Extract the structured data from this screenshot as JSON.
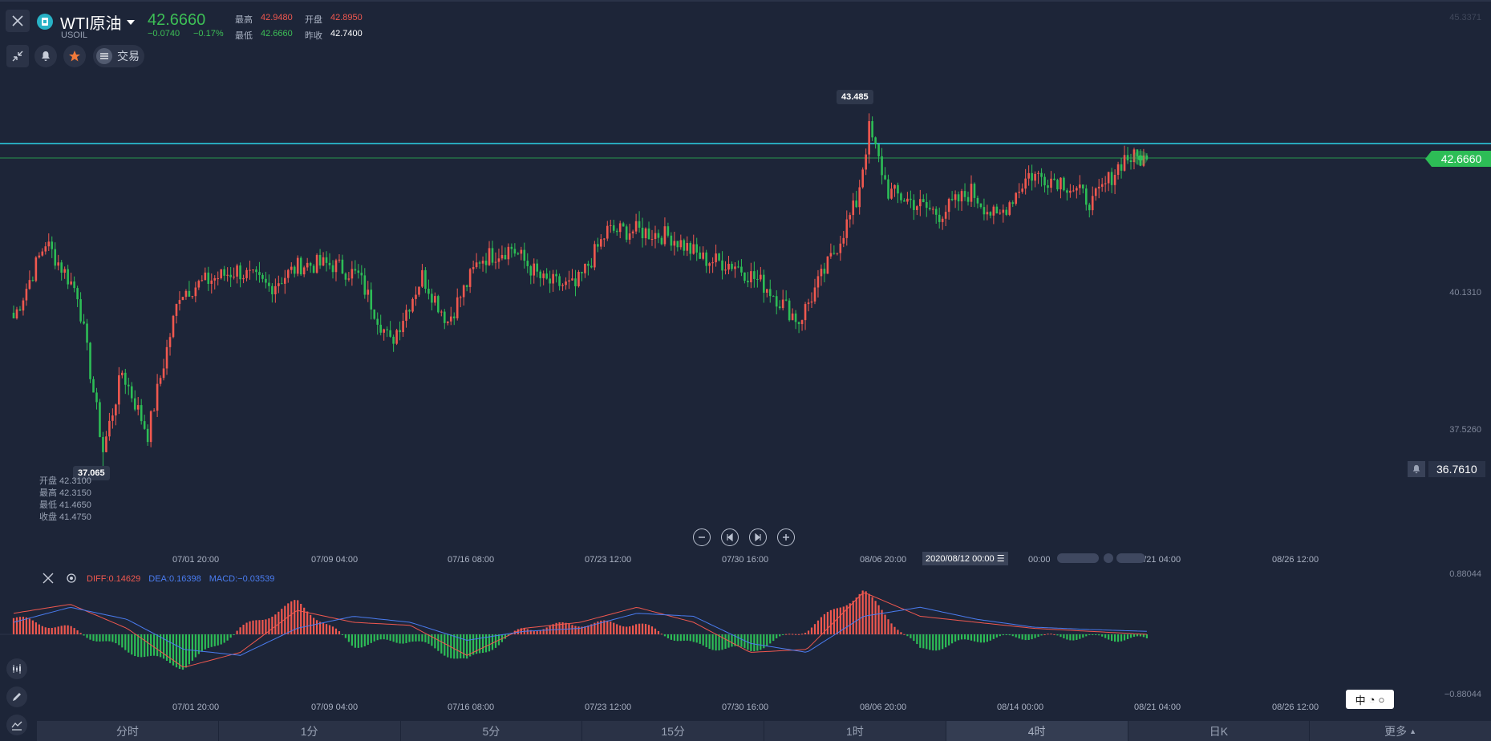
{
  "header": {
    "symbol_name": "WTI原油",
    "symbol_code": "USOIL",
    "last_price": "42.6660",
    "change": "−0.0740",
    "change_pct": "−0.17%",
    "quote": {
      "high_label": "最高",
      "high": "42.9480",
      "open_label": "开盘",
      "open": "42.8950",
      "low_label": "最低",
      "low": "42.6660",
      "prev_label": "昨收",
      "prev_close": "42.7400"
    },
    "trade_label": "交易"
  },
  "y_axis": {
    "top_label": "45.3371",
    "mid_label": "40.1310",
    "low_label": "37.5260",
    "last_price_tag": "42.6660",
    "alert_price": "36.7610"
  },
  "annotations": {
    "high": "43.485",
    "low": "37.065"
  },
  "ohlc_box": {
    "open": "开盘 42.3100",
    "high": "最高 42.3150",
    "low": "最低 41.4650",
    "close": "收盘 41.4750"
  },
  "x_axis_labels": [
    "07/01 20:00",
    "07/09 04:00",
    "07/16 08:00",
    "07/23 12:00",
    "07/30 16:00",
    "08/06 20:00",
    "00:00",
    "08/21 04:00",
    "08/26 12:00"
  ],
  "crosshair_time": "2020/08/12 00:00",
  "macd": {
    "diff_label": "DIFF:0.14629",
    "dea_label": "DEA:0.16398",
    "macd_label": "MACD:−0.03539",
    "axis_top": "0.88044",
    "axis_bottom": "−0.88044"
  },
  "macd_x_labels": [
    "07/01 20:00",
    "07/09 04:00",
    "07/16 08:00",
    "07/23 12:00",
    "07/30 16:00",
    "08/06 20:00",
    "08/14 00:00",
    "08/21 04:00",
    "08/26 12:00"
  ],
  "language_badge": "中",
  "timeframe_tabs": [
    "分时",
    "1分",
    "5分",
    "15分",
    "1时",
    "4时",
    "日K",
    "更多"
  ],
  "active_tab": "4时",
  "colors": {
    "up": "#f0584f",
    "down": "#2dbd56",
    "bg": "#1d2538",
    "diff": "#f0584f",
    "dea": "#4a7cf0",
    "last_line": "#2dd4e8"
  },
  "chart_data": {
    "type": "candlestick",
    "title": "",
    "xlabel": "",
    "ylabel": "",
    "y_range": [
      37.0,
      44.6
    ],
    "anchors": [
      {
        "index": 0,
        "close": 39.85
      },
      {
        "index": 10,
        "close": 41.2
      },
      {
        "index": 20,
        "close": 40.3
      },
      {
        "index": 28,
        "close": 37.5
      },
      {
        "index": 34,
        "close": 38.9
      },
      {
        "index": 42,
        "close": 37.8
      },
      {
        "index": 52,
        "close": 40.3
      },
      {
        "index": 60,
        "close": 40.5
      },
      {
        "index": 70,
        "close": 40.7
      },
      {
        "index": 80,
        "close": 40.4
      },
      {
        "index": 90,
        "close": 40.8
      },
      {
        "index": 100,
        "close": 40.8
      },
      {
        "index": 108,
        "close": 40.6
      },
      {
        "index": 118,
        "close": 39.4
      },
      {
        "index": 128,
        "close": 40.6
      },
      {
        "index": 136,
        "close": 39.8
      },
      {
        "index": 146,
        "close": 40.9
      },
      {
        "index": 156,
        "close": 41.1
      },
      {
        "index": 166,
        "close": 40.5
      },
      {
        "index": 176,
        "close": 40.4
      },
      {
        "index": 186,
        "close": 41.4
      },
      {
        "index": 196,
        "close": 41.4
      },
      {
        "index": 206,
        "close": 41.3
      },
      {
        "index": 216,
        "close": 40.9
      },
      {
        "index": 226,
        "close": 40.8
      },
      {
        "index": 236,
        "close": 40.4
      },
      {
        "index": 246,
        "close": 39.8
      },
      {
        "index": 256,
        "close": 40.9
      },
      {
        "index": 264,
        "close": 41.9
      },
      {
        "index": 268,
        "close": 43.2
      },
      {
        "index": 274,
        "close": 42.1
      },
      {
        "index": 282,
        "close": 41.9
      },
      {
        "index": 290,
        "close": 41.7
      },
      {
        "index": 300,
        "close": 42.1
      },
      {
        "index": 308,
        "close": 41.6
      },
      {
        "index": 318,
        "close": 42.4
      },
      {
        "index": 328,
        "close": 42.3
      },
      {
        "index": 338,
        "close": 41.9
      },
      {
        "index": 348,
        "close": 42.7
      },
      {
        "index": 355,
        "close": 42.67
      }
    ],
    "macd_diff": [
      0.35,
      0.5,
      0.1,
      -0.55,
      -0.3,
      0.4,
      0.2,
      0.15,
      -0.35,
      0.1,
      0.2,
      0.45,
      0.2,
      -0.3,
      -0.25,
      0.7,
      0.3,
      0.2,
      0.1,
      0.05,
      0.0
    ],
    "macd_dea": [
      0.2,
      0.45,
      0.25,
      -0.25,
      -0.35,
      0.1,
      0.3,
      0.2,
      -0.1,
      0.05,
      0.1,
      0.35,
      0.3,
      -0.15,
      -0.3,
      0.3,
      0.45,
      0.25,
      0.12,
      0.08,
      0.05
    ]
  }
}
